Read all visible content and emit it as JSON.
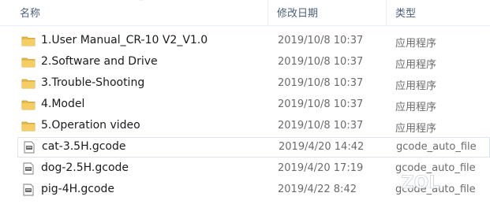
{
  "columns": {
    "name": "名称",
    "modified": "修改日期",
    "type": "类型"
  },
  "files": [
    {
      "name": "1.User Manual_CR-10 V2_V1.0",
      "modified": "2019/10/8 10:37",
      "type": "应用程序",
      "icon": "folder-icon"
    },
    {
      "name": "2.Software and Drive",
      "modified": "2019/10/8 10:37",
      "type": "应用程序",
      "icon": "folder-icon"
    },
    {
      "name": "3.Trouble-Shooting",
      "modified": "2019/10/8 10:37",
      "type": "应用程序",
      "icon": "folder-icon"
    },
    {
      "name": "4.Model",
      "modified": "2019/10/8 10:37",
      "type": "应用程序",
      "icon": "folder-icon"
    },
    {
      "name": "5.Operation video",
      "modified": "2019/10/8 10:37",
      "type": "应用程序",
      "icon": "folder-icon"
    },
    {
      "name": "cat-3.5H.gcode",
      "modified": "2019/4/20 14:42",
      "type": "gcode_auto_file",
      "icon": "gcode-file-icon",
      "selected": true
    },
    {
      "name": "dog-2.5H.gcode",
      "modified": "2019/4/20 17:19",
      "type": "gcode_auto_file",
      "icon": "gcode-file-icon"
    },
    {
      "name": "pig-4H.gcode",
      "modified": "2019/4/22 8:42",
      "type": "gcode_auto_file",
      "icon": "gcode-file-icon"
    }
  ],
  "watermark": "ZOL",
  "colors": {
    "folder": "#e8b948",
    "header_text": "#4c607a",
    "selection_border": "#dfe4ea"
  }
}
